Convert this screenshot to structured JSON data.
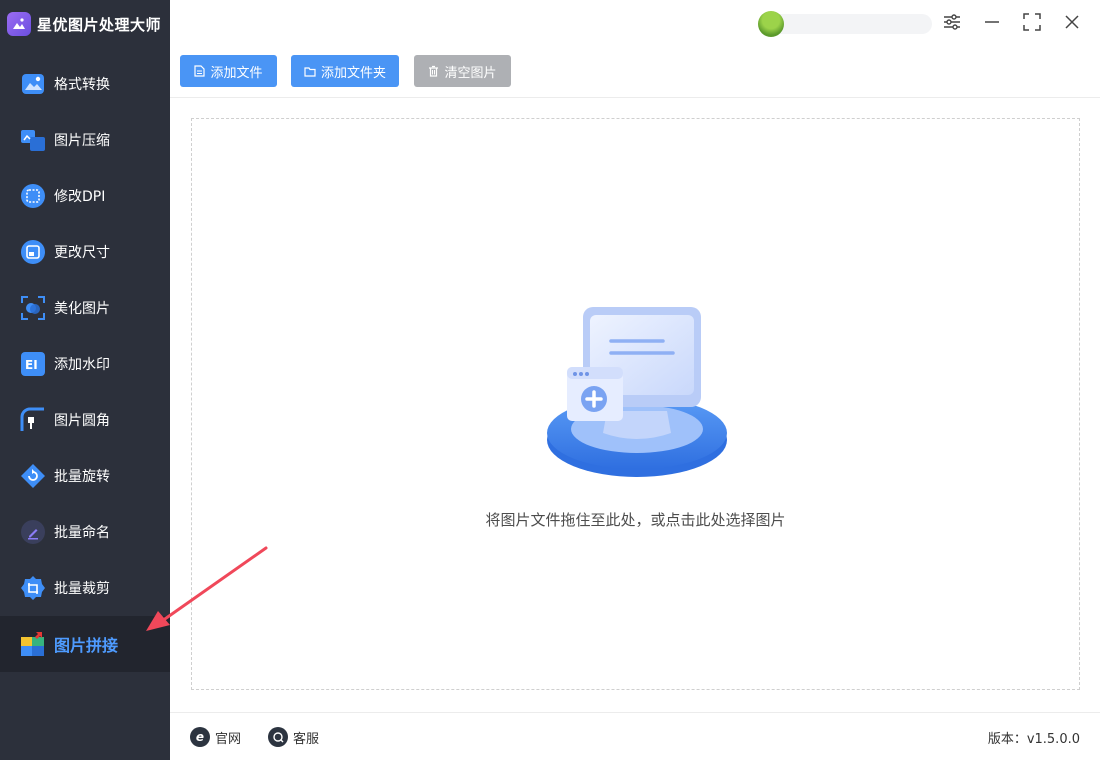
{
  "app": {
    "title": "星优图片处理大师"
  },
  "sidebar": {
    "items": [
      {
        "label": "格式转换",
        "icon": "image-convert-icon"
      },
      {
        "label": "图片压缩",
        "icon": "image-compress-icon"
      },
      {
        "label": "修改DPI",
        "icon": "dpi-icon"
      },
      {
        "label": "更改尺寸",
        "icon": "resize-icon"
      },
      {
        "label": "美化图片",
        "icon": "beautify-icon"
      },
      {
        "label": "添加水印",
        "icon": "watermark-icon"
      },
      {
        "label": "图片圆角",
        "icon": "round-corner-icon"
      },
      {
        "label": "批量旋转",
        "icon": "rotate-icon"
      },
      {
        "label": "批量命名",
        "icon": "rename-icon"
      },
      {
        "label": "批量裁剪",
        "icon": "crop-icon"
      },
      {
        "label": "图片拼接",
        "icon": "stitch-icon"
      }
    ],
    "active_index": 10
  },
  "toolbar": {
    "add_file_label": "添加文件",
    "add_folder_label": "添加文件夹",
    "clear_label": "清空图片"
  },
  "main": {
    "drop_hint": "将图片文件拖住至此处，或点击此处选择图片"
  },
  "footer": {
    "website_label": "官网",
    "support_label": "客服",
    "version_text": "版本：v1.5.0.0"
  },
  "colors": {
    "sidebar_bg": "#2c303b",
    "accent_blue": "#4a95f5",
    "active_label": "#4e9bff",
    "disabled_gray": "#aeb0b4"
  }
}
